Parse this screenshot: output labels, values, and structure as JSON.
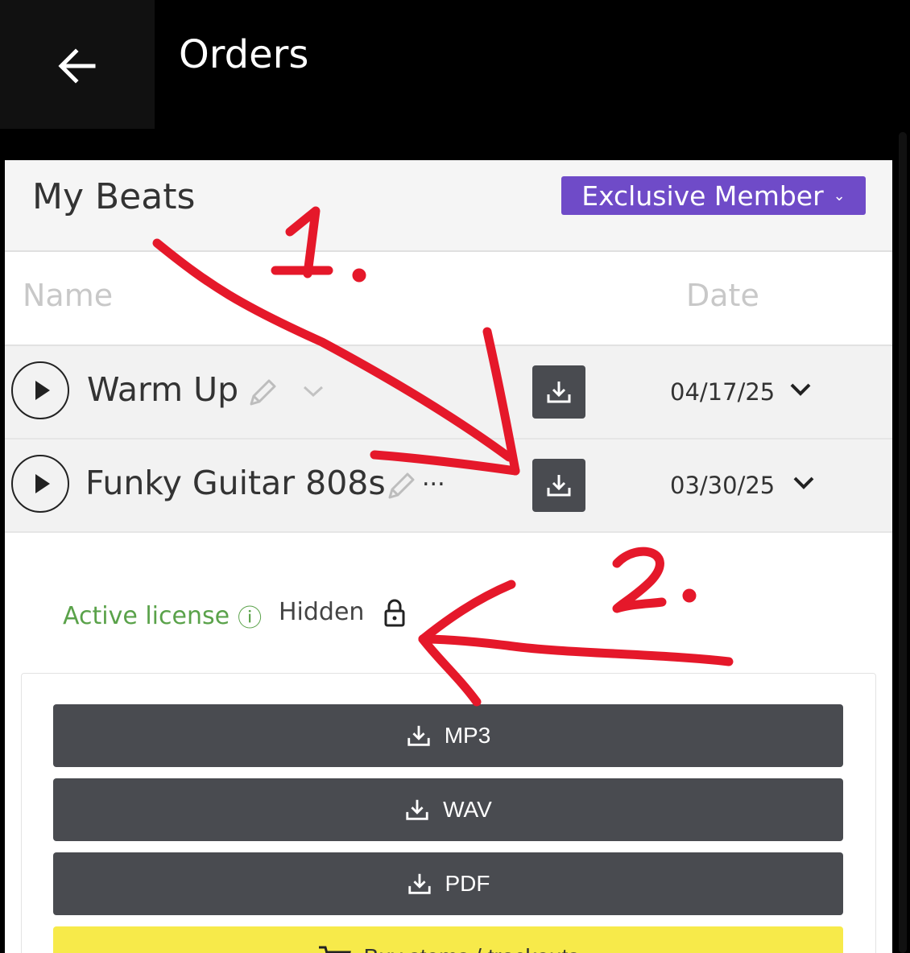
{
  "header": {
    "title": "Orders",
    "back_icon": "arrow-left-icon"
  },
  "panel": {
    "title": "My Beats",
    "membership_label": "Exclusive Member",
    "columns": {
      "name": "Name",
      "date": "Date"
    }
  },
  "beats": [
    {
      "name": "Warm Up",
      "date": "04/17/25"
    },
    {
      "name": "Funky Guitar 808s",
      "date": "03/30/25",
      "overflow": "..."
    }
  ],
  "license": {
    "status": "Active license",
    "info_icon": "ⓘ",
    "visibility": "Hidden"
  },
  "downloads": [
    {
      "label": "MP3"
    },
    {
      "label": "WAV"
    },
    {
      "label": "PDF"
    }
  ],
  "stems_button": "Buy stems / trackouts",
  "annotations": {
    "first": "1.",
    "second": "2."
  },
  "colors": {
    "accent": "#6f4bc8",
    "button": "#494b50",
    "license": "#5aa24a",
    "stems": "#f7ea4a",
    "annotation": "#e5182a"
  }
}
